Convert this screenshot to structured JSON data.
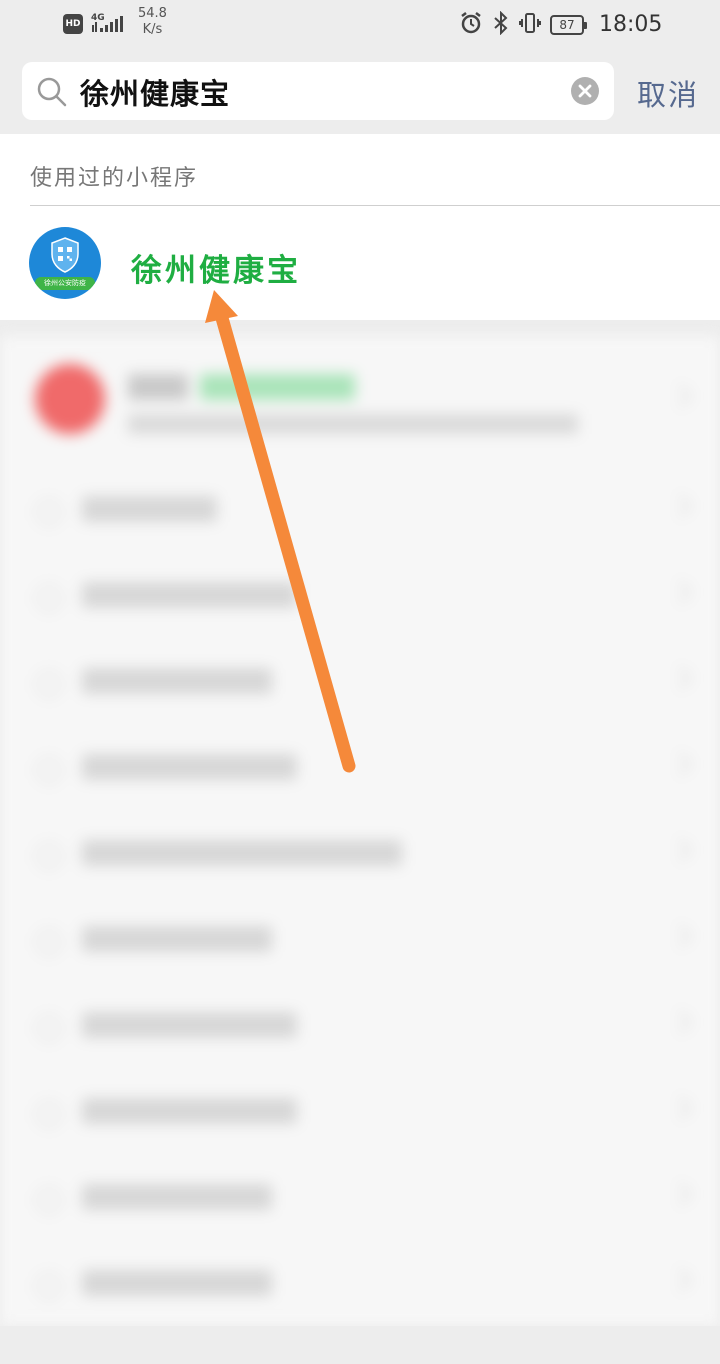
{
  "status_bar": {
    "network_badge": "HD",
    "network_type": "4G",
    "speed_value": "54.8",
    "speed_unit": "K/s",
    "battery": "87",
    "time": "18:05"
  },
  "search": {
    "query": "徐州健康宝",
    "cancel_label": "取消",
    "icons": [
      "search-icon",
      "clear-icon"
    ]
  },
  "used_miniprograms": {
    "section_title": "使用过的小程序",
    "items": [
      {
        "name": "徐州健康宝",
        "logo_caption": "徐州公安防疫"
      }
    ]
  },
  "colors": {
    "accent_green": "#1fae42",
    "cancel_blue": "#56698f",
    "arrow_orange": "#f5893a",
    "logo_blue": "#1e88d8"
  }
}
